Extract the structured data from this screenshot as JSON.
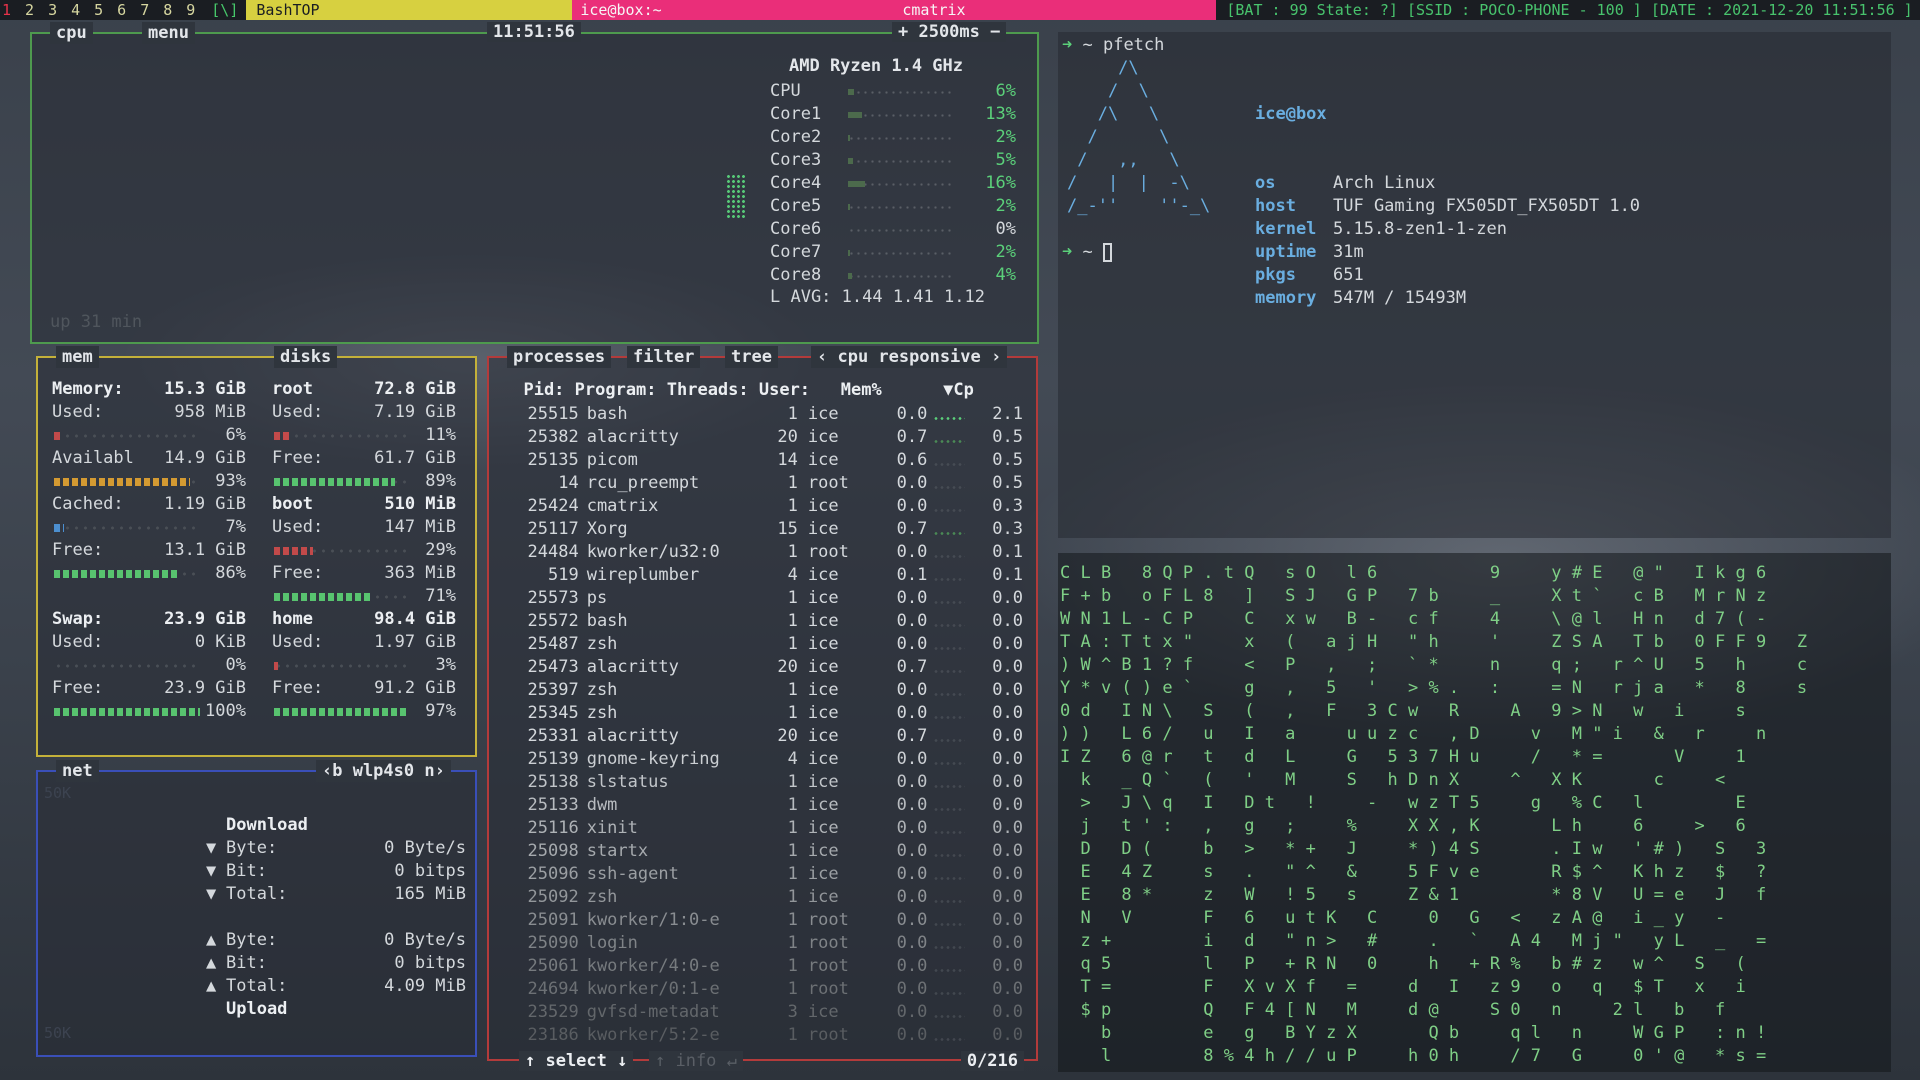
{
  "topbar": {
    "workspaces": [
      "1",
      "2",
      "3",
      "4",
      "5",
      "6",
      "7",
      "8",
      "9"
    ],
    "active_workspace": "1",
    "layout": "[\\]",
    "window_title": "BashTOP",
    "term_title": "ice@box:~",
    "term_center": "cmatrix",
    "status": "[BAT : 99 State: ?] [SSID : POCO-PHONE - 100 ] [DATE : 2021-12-20 11:51:56 ]"
  },
  "cpu": {
    "tab_cpu": "cpu",
    "tab_menu": "menu",
    "time": "11:51:56",
    "interval": "+ 2500ms −",
    "model": "AMD Ryzen  1.4 GHz",
    "rows": [
      {
        "label": "CPU",
        "pct": "6%",
        "level": 0.06,
        "grey": false
      },
      {
        "label": "Core1",
        "pct": "13%",
        "level": 0.13,
        "grey": false
      },
      {
        "label": "Core2",
        "pct": "2%",
        "level": 0.02,
        "grey": false
      },
      {
        "label": "Core3",
        "pct": "5%",
        "level": 0.05,
        "grey": false
      },
      {
        "label": "Core4",
        "pct": "16%",
        "level": 0.16,
        "grey": false
      },
      {
        "label": "Core5",
        "pct": "2%",
        "level": 0.02,
        "grey": false
      },
      {
        "label": "Core6",
        "pct": "0%",
        "level": 0.0,
        "grey": true
      },
      {
        "label": "Core7",
        "pct": "2%",
        "level": 0.02,
        "grey": false
      },
      {
        "label": "Core8",
        "pct": "4%",
        "level": 0.04,
        "grey": false
      }
    ],
    "lavg": "L AVG: 1.44 1.41 1.12",
    "uptime": "up 31 min"
  },
  "mem": {
    "tab_mem": "mem",
    "tab_disks": "disks",
    "rows": [
      {
        "k": "Memory:",
        "v": "15.3 GiB",
        "bold": true
      },
      {
        "k": "Used:",
        "v": "958 MiB"
      },
      {
        "gauge": 0.06,
        "pct": "6%",
        "color": "#c24a4a"
      },
      {
        "k": "Availabl",
        "v": "14.9 GiB"
      },
      {
        "gauge": 0.93,
        "pct": "93%",
        "color": "#d49a32"
      },
      {
        "k": "Cached:",
        "v": "1.19 GiB"
      },
      {
        "gauge": 0.07,
        "pct": "7%",
        "color": "#4c8fd0"
      },
      {
        "k": "Free:",
        "v": "13.1 GiB"
      },
      {
        "gauge": 0.86,
        "pct": "86%",
        "color": "#58c36f"
      },
      {
        "k": "",
        "v": ""
      },
      {
        "k": "Swap:",
        "v": "23.9 GiB",
        "bold": true
      },
      {
        "k": "Used:",
        "v": "0 KiB"
      },
      {
        "gauge": 0.0,
        "pct": "0%",
        "color": "#c24a4a"
      },
      {
        "k": "Free:",
        "v": "23.9 GiB"
      },
      {
        "gauge": 1.0,
        "pct": "100%",
        "color": "#58c36f"
      }
    ],
    "disks": [
      {
        "k": "root",
        "v": "72.8 GiB",
        "bold": true
      },
      {
        "k": "Used:",
        "v": "7.19 GiB"
      },
      {
        "gauge": 0.11,
        "pct": "11%",
        "color": "#c24a4a"
      },
      {
        "k": "Free:",
        "v": "61.7 GiB"
      },
      {
        "gauge": 0.89,
        "pct": "89%",
        "color": "#58c36f"
      },
      {
        "k": "boot",
        "v": "510 MiB",
        "bold": true
      },
      {
        "k": "Used:",
        "v": "147 MiB"
      },
      {
        "gauge": 0.29,
        "pct": "29%",
        "color": "#c24a4a"
      },
      {
        "k": "Free:",
        "v": "363 MiB"
      },
      {
        "gauge": 0.71,
        "pct": "71%",
        "color": "#58c36f"
      },
      {
        "k": "home",
        "v": "98.4 GiB",
        "bold": true
      },
      {
        "k": "Used:",
        "v": "1.97 GiB"
      },
      {
        "gauge": 0.03,
        "pct": "3%",
        "color": "#c24a4a"
      },
      {
        "k": "Free:",
        "v": "91.2 GiB"
      },
      {
        "gauge": 0.97,
        "pct": "97%",
        "color": "#58c36f"
      }
    ]
  },
  "net": {
    "tab": "net",
    "iface": "‹b wlp4s0 n›",
    "scale_top": "50K",
    "scale_bottom": "50K",
    "download_label": "Download",
    "upload_label": "Upload",
    "down": [
      {
        "k": "Byte:",
        "v": "0 Byte/s"
      },
      {
        "k": "Bit:",
        "v": "0 bitps"
      },
      {
        "k": "Total:",
        "v": "165 MiB"
      }
    ],
    "up": [
      {
        "k": "Byte:",
        "v": "0 Byte/s"
      },
      {
        "k": "Bit:",
        "v": "0 bitps"
      },
      {
        "k": "Total:",
        "v": "4.09 MiB"
      }
    ]
  },
  "proc": {
    "tab_processes": "processes",
    "tab_filter": "filter",
    "tab_tree": "tree",
    "sort": "‹ cpu responsive ›",
    "header": "  Pid: Program: Threads: User:   Mem%      ▼Cp",
    "footer_select": "↑ select ↓",
    "footer_info": "↑ info ↵",
    "count": "0/216",
    "rows": [
      {
        "pid": "25515",
        "prog": "bash",
        "thr": "1",
        "user": "ice",
        "mem": "0.0",
        "cpu": "2.1",
        "g": "#5bd07a"
      },
      {
        "pid": "25382",
        "prog": "alacritty",
        "thr": "20",
        "user": "ice",
        "mem": "0.7",
        "cpu": "0.5",
        "g": "#4a8a55"
      },
      {
        "pid": "25135",
        "prog": "picom",
        "thr": "14",
        "user": "ice",
        "mem": "0.6",
        "cpu": "0.5",
        "g": ""
      },
      {
        "pid": "14",
        "prog": "rcu_preempt",
        "thr": "1",
        "user": "root",
        "mem": "0.0",
        "cpu": "0.5",
        "g": ""
      },
      {
        "pid": "25424",
        "prog": "cmatrix",
        "thr": "1",
        "user": "ice",
        "mem": "0.0",
        "cpu": "0.3",
        "g": ""
      },
      {
        "pid": "25117",
        "prog": "Xorg",
        "thr": "15",
        "user": "ice",
        "mem": "0.7",
        "cpu": "0.3",
        "g": "#4a8a55"
      },
      {
        "pid": "24484",
        "prog": "kworker/u32:0",
        "thr": "1",
        "user": "root",
        "mem": "0.0",
        "cpu": "0.1",
        "g": ""
      },
      {
        "pid": "519",
        "prog": "wireplumber",
        "thr": "4",
        "user": "ice",
        "mem": "0.1",
        "cpu": "0.1",
        "g": ""
      },
      {
        "pid": "25573",
        "prog": "ps",
        "thr": "1",
        "user": "ice",
        "mem": "0.0",
        "cpu": "0.0",
        "g": ""
      },
      {
        "pid": "25572",
        "prog": "bash",
        "thr": "1",
        "user": "ice",
        "mem": "0.0",
        "cpu": "0.0",
        "g": ""
      },
      {
        "pid": "25487",
        "prog": "zsh",
        "thr": "1",
        "user": "ice",
        "mem": "0.0",
        "cpu": "0.0",
        "g": ""
      },
      {
        "pid": "25473",
        "prog": "alacritty",
        "thr": "20",
        "user": "ice",
        "mem": "0.7",
        "cpu": "0.0",
        "g": ""
      },
      {
        "pid": "25397",
        "prog": "zsh",
        "thr": "1",
        "user": "ice",
        "mem": "0.0",
        "cpu": "0.0",
        "g": ""
      },
      {
        "pid": "25345",
        "prog": "zsh",
        "thr": "1",
        "user": "ice",
        "mem": "0.0",
        "cpu": "0.0",
        "g": ""
      },
      {
        "pid": "25331",
        "prog": "alacritty",
        "thr": "20",
        "user": "ice",
        "mem": "0.7",
        "cpu": "0.0",
        "g": ""
      },
      {
        "pid": "25139",
        "prog": "gnome-keyring",
        "thr": "4",
        "user": "ice",
        "mem": "0.0",
        "cpu": "0.0",
        "g": ""
      },
      {
        "pid": "25138",
        "prog": "slstatus",
        "thr": "1",
        "user": "ice",
        "mem": "0.0",
        "cpu": "0.0",
        "g": ""
      },
      {
        "pid": "25133",
        "prog": "dwm",
        "thr": "1",
        "user": "ice",
        "mem": "0.0",
        "cpu": "0.0",
        "g": ""
      },
      {
        "pid": "25116",
        "prog": "xinit",
        "thr": "1",
        "user": "ice",
        "mem": "0.0",
        "cpu": "0.0",
        "g": ""
      },
      {
        "pid": "25098",
        "prog": "startx",
        "thr": "1",
        "user": "ice",
        "mem": "0.0",
        "cpu": "0.0",
        "g": ""
      },
      {
        "pid": "25096",
        "prog": "ssh-agent",
        "thr": "1",
        "user": "ice",
        "mem": "0.0",
        "cpu": "0.0",
        "g": ""
      },
      {
        "pid": "25092",
        "prog": "zsh",
        "thr": "1",
        "user": "ice",
        "mem": "0.0",
        "cpu": "0.0",
        "g": ""
      },
      {
        "pid": "25091",
        "prog": "kworker/1:0-e",
        "thr": "1",
        "user": "root",
        "mem": "0.0",
        "cpu": "0.0",
        "g": ""
      },
      {
        "pid": "25090",
        "prog": "login",
        "thr": "1",
        "user": "root",
        "mem": "0.0",
        "cpu": "0.0",
        "g": ""
      },
      {
        "pid": "25061",
        "prog": "kworker/4:0-e",
        "thr": "1",
        "user": "root",
        "mem": "0.0",
        "cpu": "0.0",
        "g": ""
      },
      {
        "pid": "24694",
        "prog": "kworker/0:1-e",
        "thr": "1",
        "user": "root",
        "mem": "0.0",
        "cpu": "0.0",
        "g": ""
      },
      {
        "pid": "23529",
        "prog": "gvfsd-metadat",
        "thr": "3",
        "user": "ice",
        "mem": "0.0",
        "cpu": "0.0",
        "g": ""
      },
      {
        "pid": "23186",
        "prog": "kworker/5:2-e",
        "thr": "1",
        "user": "root",
        "mem": "0.0",
        "cpu": "0.0",
        "g": ""
      }
    ]
  },
  "terminal": {
    "prompt1": "~ pfetch",
    "prompt2": "~",
    "ascii": "     /\\\n    /  \\\n   /\\   \\\n  /      \\\n /   ,,   \\\n/   |  |  -\\\n/_-''    ''-_\\",
    "user_host": "ice@box",
    "fields": [
      {
        "k": "os",
        "v": "Arch Linux"
      },
      {
        "k": "host",
        "v": "TUF Gaming FX505DT_FX505DT 1.0"
      },
      {
        "k": "kernel",
        "v": "5.15.8-zen1-1-zen"
      },
      {
        "k": "uptime",
        "v": "31m"
      },
      {
        "k": "pkgs",
        "v": "651"
      },
      {
        "k": "memory",
        "v": "547M / 15493M"
      }
    ]
  },
  "matrix": {
    "rows": [
      "C L B   8 Q P . t Q   s O   l 6           9     y # E   @ \"   I k g 6",
      "F + b   o F L 8   ]   S J   G P   7 b     _     X t `   c B   M r N z",
      "W N 1 L - C P     C   x w   B -   c f     4     \\ @ l   H n   d 7 ( -",
      "T A : T t x \"     x   (   a j H   \" h     '     Z S A   T b   0 F F 9   Z",
      ") W ^ B 1 ? f     <   P   ,   ;   ` *     n     q ;   r ^ U   5   h     c",
      "Y * v ( ) e `     g   ,   5   '   > % .   :     = N   r j a   *   8     s",
      "0 d   I N \\   S   (   ,   F   3 C w   R     A   9 > N   w   i     s",
      ") )   L 6 /   u   I   a     u u z c   , D     v   M \" i   &   r     n",
      "I Z   6 @ r   t   d   L     G   5 3 7 H u     /   * =       V     1",
      "  k   _ Q `   (   '   M     S   h D n X     ^   X K       c     <",
      "  >   J \\ q   I   D t   !     -   w z T 5     g   % C   l         E",
      "  j   t ' :   ,   g   ;     %     X X , K       L h     6     >   6",
      "  D   D (     b   >   * +   J     * ) 4 S       . I w   ' # )   S   3",
      "  E   4 Z     s   .   \" ^   &     5 F v e       R $ ^   K h z   $   ?",
      "  E   8 *     z   W   ! 5   s     Z & 1         * 8 V   U = e   J   f",
      "  N   V       F   6   u t K   C     0   G   <   z A @   i _ y   -",
      "  z +         i   d   \" n >   #     .   `   A 4   M j \"   y L   _   =",
      "  q 5         l   P   + R N   0     h   + R %   b # z   w ^   S   (",
      "  T =         F   X v X f   =     d   I   z 9   o   q   $ T   x   i",
      "  $ p         Q   F 4 [ N   M     d @     S 0   n     2 l   b   f",
      "    b         e   g   B Y z X       Q b     q l   n     W G P   : n !",
      "    l         8 % 4 h / / u P     h 0 h     / 7   G     0 ' @   * s ="
    ]
  }
}
